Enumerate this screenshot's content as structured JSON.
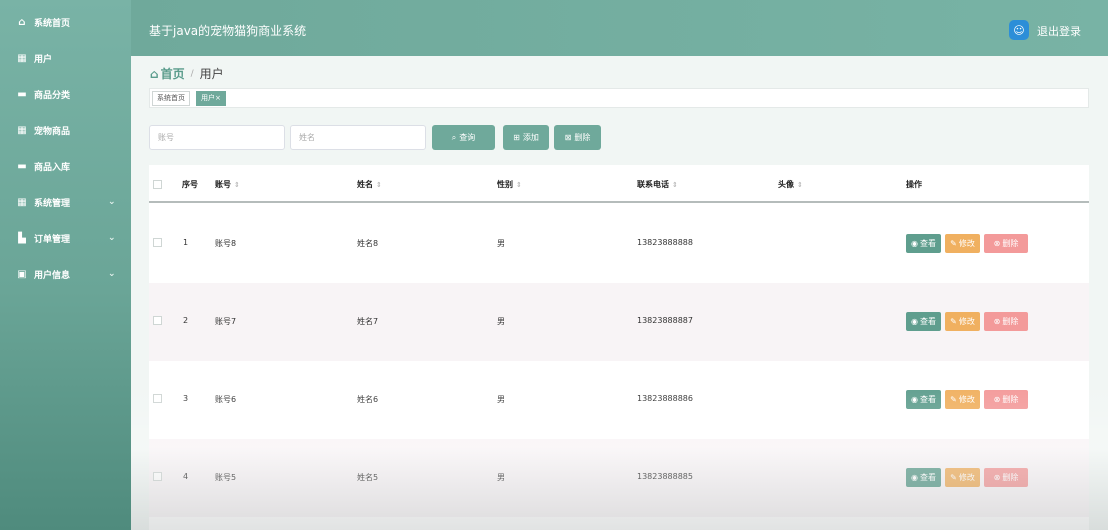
{
  "sidebar": {
    "items": [
      {
        "label": "系统首页",
        "icon": "home-icon",
        "glyph": "⌂"
      },
      {
        "label": "用户",
        "icon": "grid-icon",
        "glyph": "▦"
      },
      {
        "label": "商品分类",
        "icon": "chat-icon",
        "glyph": "▬"
      },
      {
        "label": "宠物商品",
        "icon": "grid-icon",
        "glyph": "▦"
      },
      {
        "label": "商品入库",
        "icon": "box-icon",
        "glyph": "▬"
      },
      {
        "label": "系统管理",
        "icon": "table-icon",
        "glyph": "▦",
        "chevron": "⌄"
      },
      {
        "label": "订单管理",
        "icon": "chart-icon",
        "glyph": "▙",
        "chevron": "⌄"
      },
      {
        "label": "用户信息",
        "icon": "window-icon",
        "glyph": "▣",
        "chevron": "⌄"
      }
    ]
  },
  "header": {
    "title": "基于java的宠物猫狗商业系统",
    "logout": "退出登录",
    "avatar_glyph": "☺"
  },
  "breadcrumb": {
    "home": "首页",
    "home_glyph": "⌂",
    "separator": "/",
    "current": "用户"
  },
  "tags": {
    "home": "系统首页",
    "active": "用户",
    "close": "×"
  },
  "search": {
    "account_placeholder": "账号",
    "name_placeholder": "姓名",
    "query_label": "查询",
    "query_glyph": "⌕",
    "add_label": "添加",
    "add_glyph": "⊞",
    "delete_label": "删除",
    "delete_glyph": "⊠"
  },
  "table": {
    "columns": [
      "序号",
      "账号",
      "姓名",
      "性别",
      "联系电话",
      "头像",
      "操作"
    ],
    "sort_glyph": "⇕",
    "rows": [
      {
        "index": "1",
        "account": "账号8",
        "name": "姓名8",
        "gender": "男",
        "phone": "13823888888"
      },
      {
        "index": "2",
        "account": "账号7",
        "name": "姓名7",
        "gender": "男",
        "phone": "13823888887"
      },
      {
        "index": "3",
        "account": "账号6",
        "name": "姓名6",
        "gender": "男",
        "phone": "13823888886"
      },
      {
        "index": "4",
        "account": "账号5",
        "name": "姓名5",
        "gender": "男",
        "phone": "13823888885"
      }
    ],
    "actions": {
      "view": "查看",
      "view_glyph": "◉",
      "edit": "修改",
      "edit_glyph": "✎",
      "delete": "删除",
      "delete_glyph": "⊗"
    }
  },
  "colors": {
    "primary": "#6fa99b",
    "edit": "#f0b060",
    "delete": "#f39a9a"
  }
}
